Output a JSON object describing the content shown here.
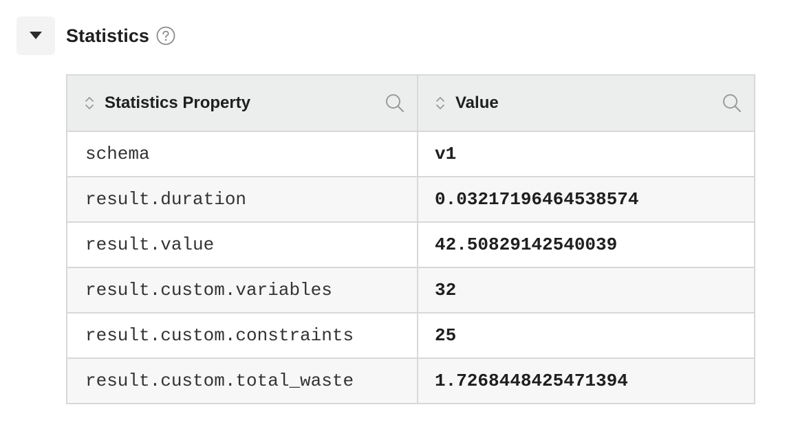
{
  "section": {
    "title": "Statistics",
    "toggle_icon": "caret-down-icon",
    "help_icon": "question-circle-icon"
  },
  "table": {
    "columns": [
      {
        "label": "Statistics Property",
        "sort_icon": "sort-updown-icon",
        "filter_icon": "search-icon"
      },
      {
        "label": "Value",
        "sort_icon": "sort-updown-icon",
        "filter_icon": "search-icon"
      }
    ],
    "rows": [
      {
        "property": "schema",
        "value": "v1"
      },
      {
        "property": "result.duration",
        "value": "0.03217196464538574"
      },
      {
        "property": "result.value",
        "value": "42.50829142540039"
      },
      {
        "property": "result.custom.variables",
        "value": "32"
      },
      {
        "property": "result.custom.constraints",
        "value": "25"
      },
      {
        "property": "result.custom.total_waste",
        "value": "1.7268448425471394"
      }
    ]
  },
  "colors": {
    "header_bg": "#eceeee",
    "border": "#d8d8d8",
    "zebra": "#f7f7f7",
    "icon_gray": "#9a9a9a"
  }
}
